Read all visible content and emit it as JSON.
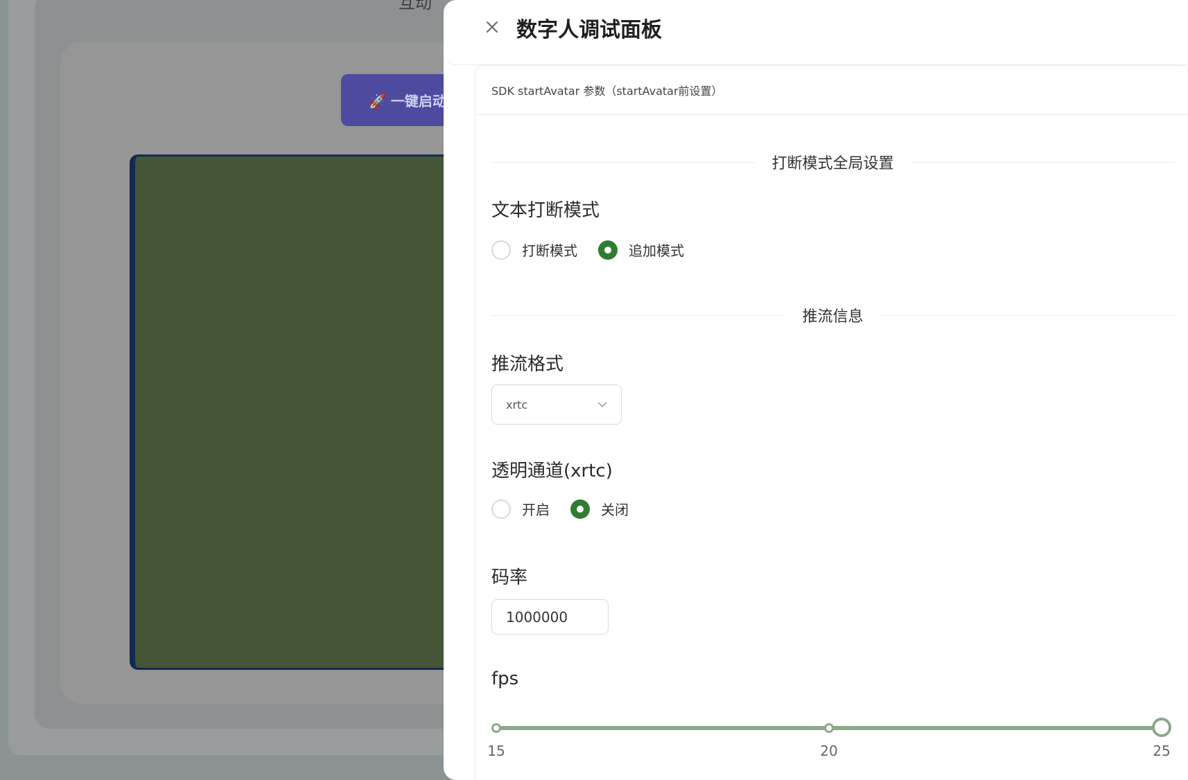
{
  "background": {
    "title_fragment": "互动",
    "launch_button": "🚀 一键启动"
  },
  "drawer": {
    "title": "数字人调试面板",
    "card_title": "SDK startAvatar 参数（startAvatar前设置）",
    "interrupt_section": {
      "divider": "打断模式全局设置",
      "label": "文本打断模式",
      "options": [
        "打断模式",
        "追加模式"
      ],
      "selected": "追加模式"
    },
    "stream_section": {
      "divider": "推流信息",
      "format_label": "推流格式",
      "format_value": "xrtc",
      "alpha_label": "透明通道(xrtc)",
      "alpha_options": [
        "开启",
        "关闭"
      ],
      "alpha_selected": "关闭",
      "bitrate_label": "码率",
      "bitrate_value": "1000000",
      "fps_label": "fps",
      "fps": {
        "min": 15,
        "max": 25,
        "value": 25,
        "marks": [
          "15",
          "20",
          "25"
        ]
      }
    }
  },
  "colors": {
    "accent": "#2e7d32",
    "slider": "#8da88a"
  }
}
